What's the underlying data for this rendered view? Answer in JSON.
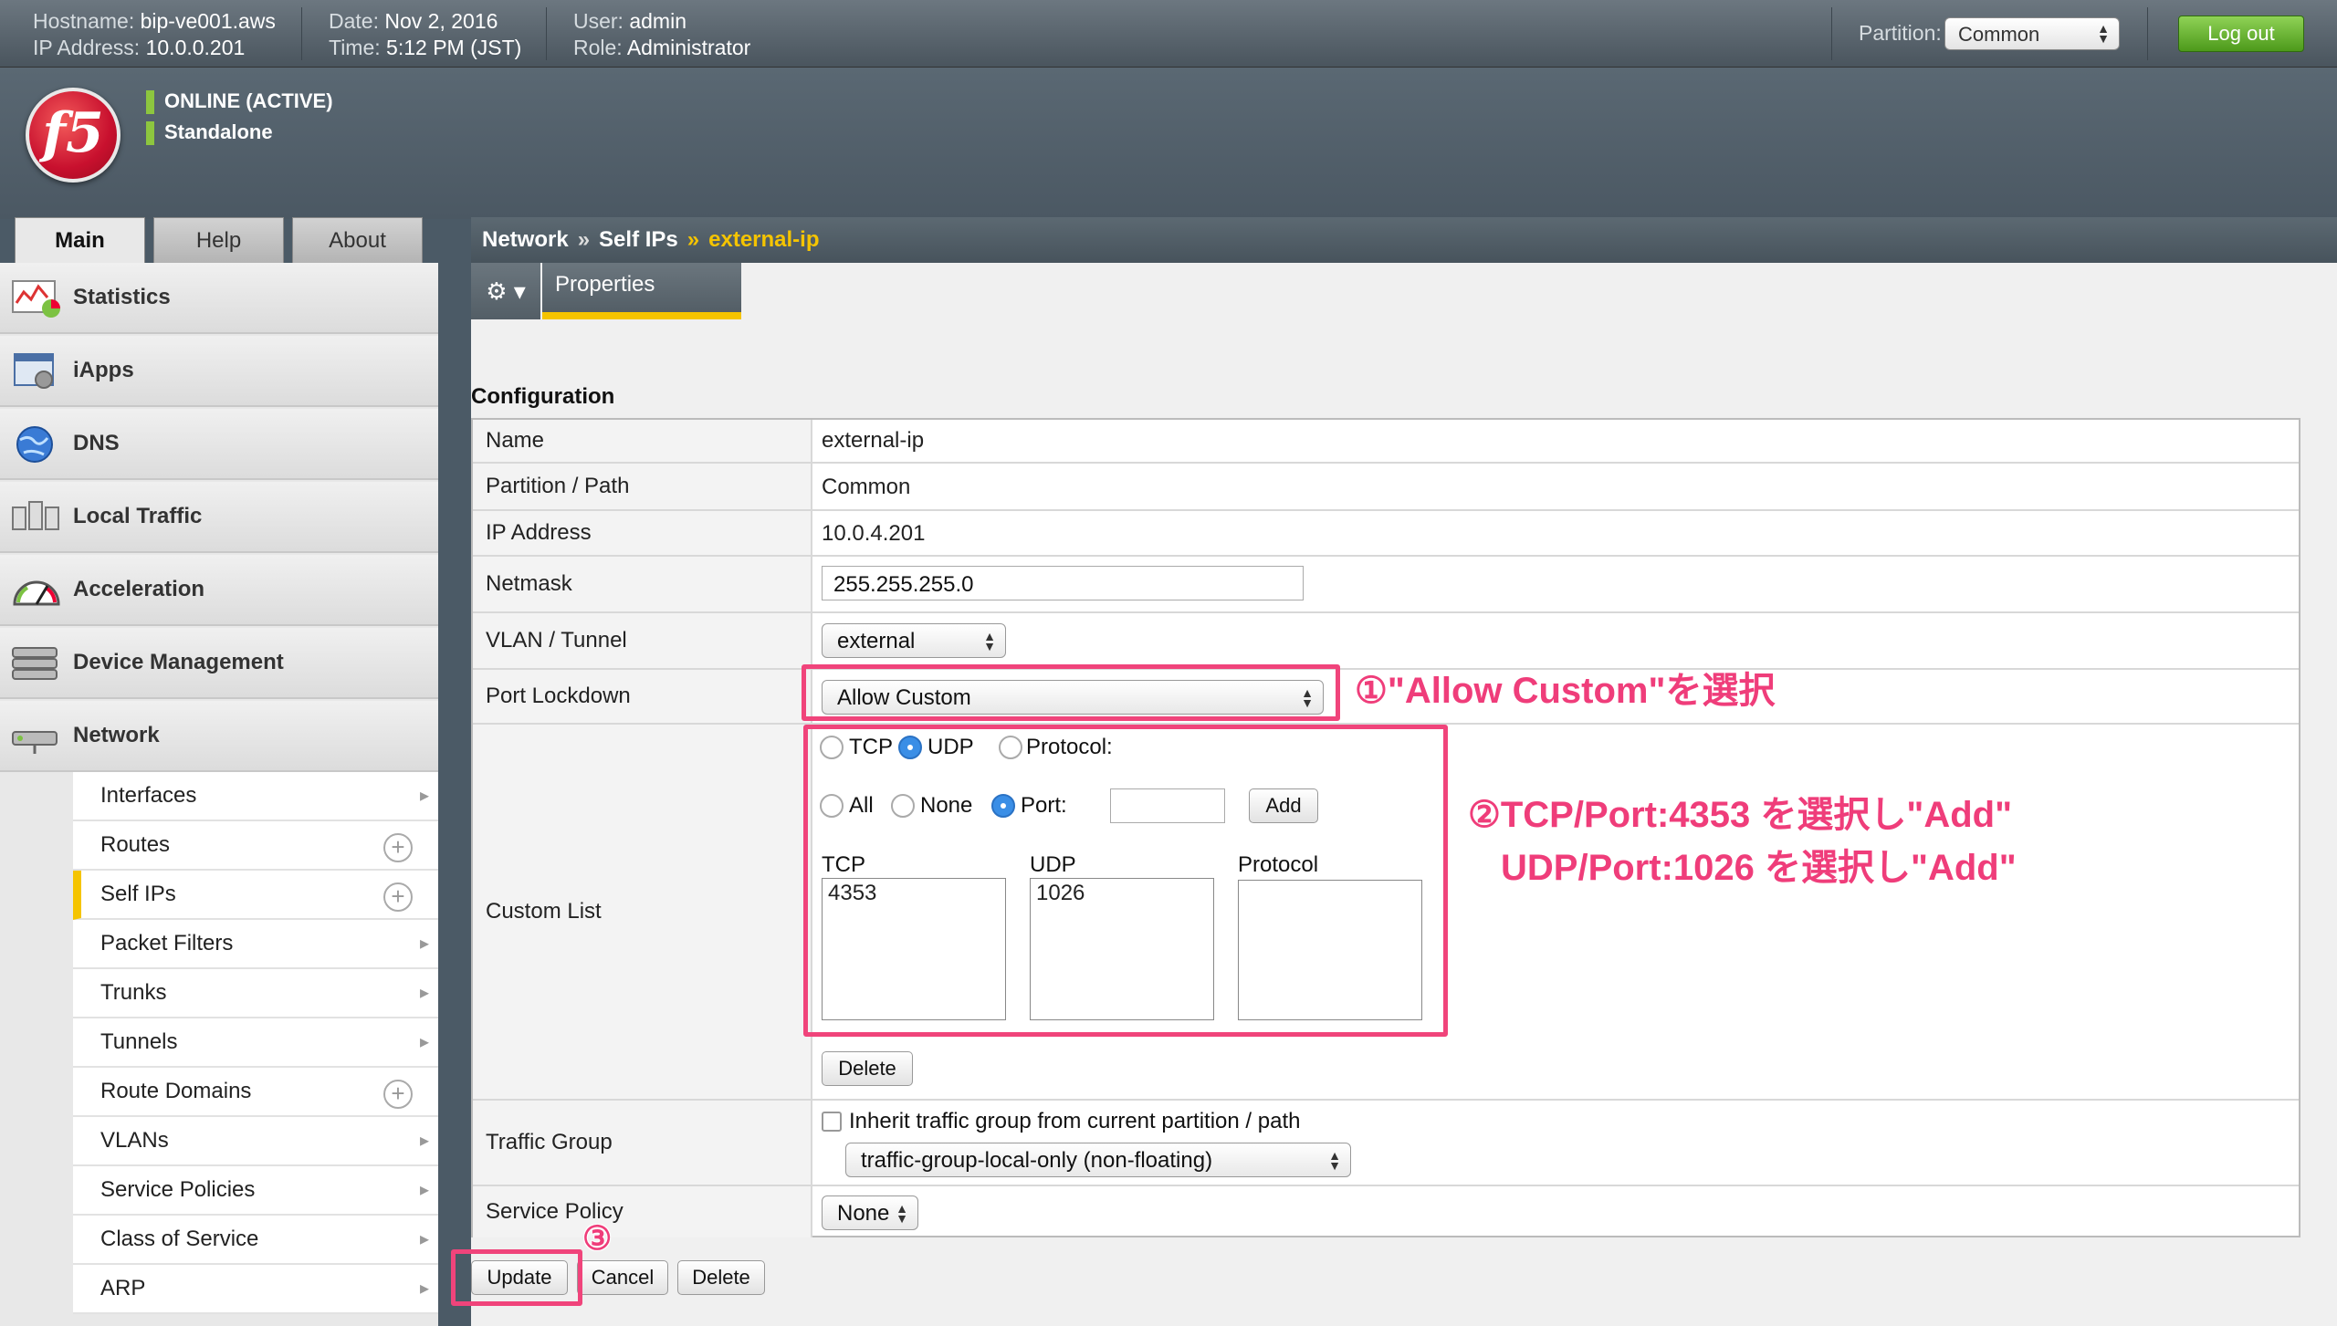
{
  "topbar": {
    "hostname_label": "Hostname:",
    "hostname": "bip-ve001.aws",
    "ip_label": "IP Address:",
    "ip": "10.0.0.201",
    "date_label": "Date:",
    "date": "Nov 2, 2016",
    "time_label": "Time:",
    "time": "5:12 PM (JST)",
    "user_label": "User:",
    "user": "admin",
    "role_label": "Role:",
    "role": "Administrator",
    "partition_label": "Partition:",
    "partition_value": "Common",
    "logout_label": "Log out"
  },
  "banner": {
    "logo_text": "f5",
    "status": "ONLINE (ACTIVE)",
    "mode": "Standalone"
  },
  "nav_tabs": [
    "Main",
    "Help",
    "About"
  ],
  "sidebar": {
    "items": [
      "Statistics",
      "iApps",
      "DNS",
      "Local Traffic",
      "Acceleration",
      "Device Management",
      "Network"
    ],
    "subitems": [
      "Interfaces",
      "Routes",
      "Self IPs",
      "Packet Filters",
      "Trunks",
      "Tunnels",
      "Route Domains",
      "VLANs",
      "Service Policies",
      "Class of Service",
      "ARP"
    ]
  },
  "breadcrumb": {
    "part1": "Network",
    "sep": "»",
    "part2": "Self IPs",
    "current": "external-ip"
  },
  "tabs": {
    "properties": "Properties",
    "gear": "⚙ ▾"
  },
  "config": {
    "title": "Configuration",
    "name_label": "Name",
    "name_value": "external-ip",
    "partition_label": "Partition / Path",
    "partition_value": "Common",
    "ip_label": "IP Address",
    "ip_value": "10.0.4.201",
    "netmask_label": "Netmask",
    "netmask_value": "255.255.255.0",
    "vlan_label": "VLAN / Tunnel",
    "vlan_value": "external",
    "lockdown_label": "Port Lockdown",
    "lockdown_value": "Allow Custom",
    "custom_label": "Custom List",
    "proto_tcp": "TCP",
    "proto_udp": "UDP",
    "proto_protocol": "Protocol:",
    "port_all": "All",
    "port_none": "None",
    "port_port": "Port:",
    "add_label": "Add",
    "list_tcp_header": "TCP",
    "list_udp_header": "UDP",
    "list_protocol_header": "Protocol",
    "list_tcp_items": [
      "4353"
    ],
    "list_udp_items": [
      "1026"
    ],
    "delete_label": "Delete",
    "traffic_label": "Traffic Group",
    "traffic_inherit": "Inherit traffic group from current partition / path",
    "traffic_value": "traffic-group-local-only (non-floating)",
    "policy_label": "Service Policy",
    "policy_value": "None"
  },
  "actions": {
    "update": "Update",
    "cancel": "Cancel",
    "delete": "Delete"
  },
  "annotations": {
    "a1": "①\"Allow Custom\"を選択",
    "a2": "②TCP/Port:4353 を選択し\"Add\"",
    "a2b": "UDP/Port:1026 を選択し\"Add\"",
    "a3": "③"
  },
  "colors": {
    "accent": "#f5c400",
    "highlight": "#f0447b",
    "status": "#8dc63f",
    "logout": "#5aa824"
  }
}
